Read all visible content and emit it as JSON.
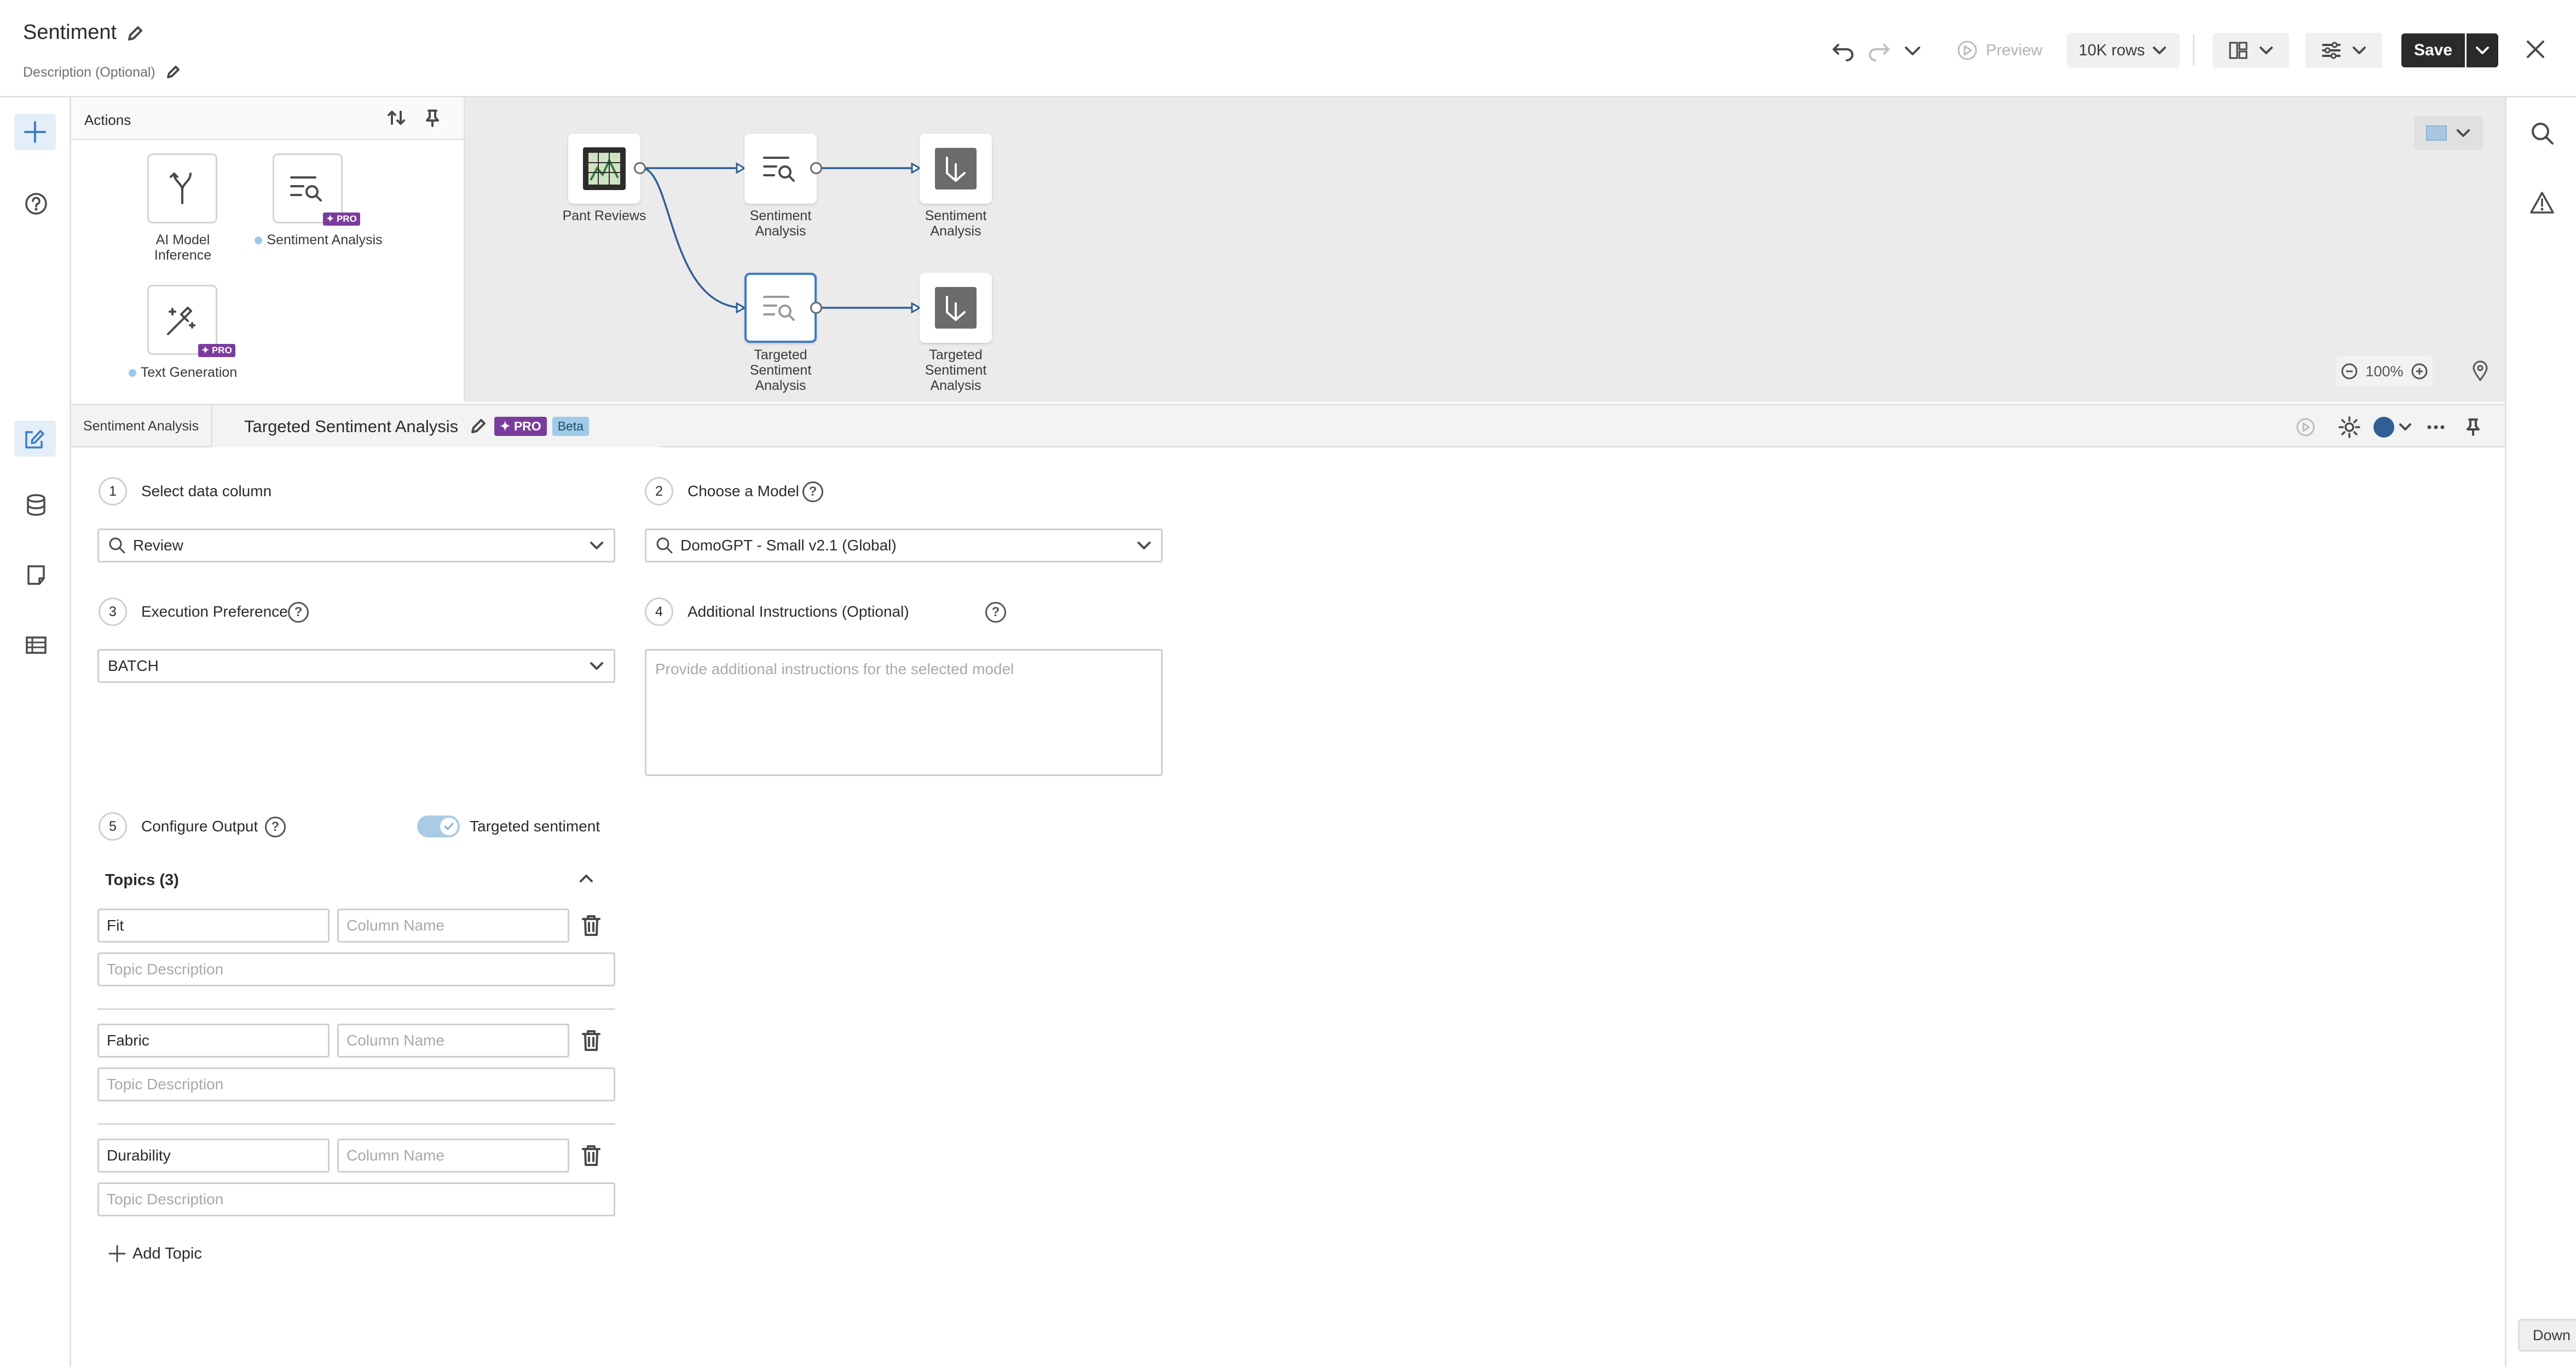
{
  "header": {
    "title": "Sentiment",
    "description": "Description (Optional)",
    "preview_label": "Preview",
    "rows_label": "10K rows",
    "save_label": "Save"
  },
  "actions": {
    "title": "Actions",
    "tiles": [
      {
        "label": "AI Model Inference",
        "pro": false,
        "icon": "fork-icon"
      },
      {
        "label": "Sentiment Analysis",
        "pro": true,
        "icon": "text-search-icon"
      },
      {
        "label": "Text Generation",
        "pro": true,
        "icon": "magic-wand-icon"
      }
    ],
    "pro_badge": "PRO"
  },
  "canvas": {
    "nodes": [
      {
        "label": "Pant Reviews"
      },
      {
        "label": "Sentiment Analysis"
      },
      {
        "label": "Sentiment Analysis"
      },
      {
        "label": "Targeted Sentiment Analysis"
      },
      {
        "label": "Targeted Sentiment Analysis"
      }
    ],
    "zoom": "100%"
  },
  "tabs": {
    "tab1": "Sentiment Analysis",
    "tab2": "Targeted Sentiment Analysis",
    "pro_badge": "PRO",
    "beta_badge": "Beta"
  },
  "form": {
    "step1": {
      "num": "1",
      "label": "Select data column",
      "value": "Review"
    },
    "step2": {
      "num": "2",
      "label": "Choose a Model",
      "value": "DomoGPT - Small v2.1 (Global)"
    },
    "step3": {
      "num": "3",
      "label": "Execution Preference",
      "value": "BATCH"
    },
    "step4": {
      "num": "4",
      "label": "Additional Instructions (Optional)",
      "placeholder": "Provide additional instructions for the selected model"
    },
    "step5": {
      "num": "5",
      "label": "Configure Output",
      "toggle_label": "Targeted sentiment",
      "toggle_on": true
    },
    "topics_title": "Topics (3)",
    "topics": [
      {
        "name": "Fit",
        "column_placeholder": "Column Name",
        "desc_placeholder": "Topic Description"
      },
      {
        "name": "Fabric",
        "column_placeholder": "Column Name",
        "desc_placeholder": "Topic Description"
      },
      {
        "name": "Durability",
        "column_placeholder": "Column Name",
        "desc_placeholder": "Topic Description"
      }
    ],
    "add_topic": "Add Topic"
  },
  "footer": {
    "corner_label": "Down"
  },
  "colors": {
    "accent": "#3d7cc9",
    "pro": "#7a3c9c",
    "beta": "#9fcbe9",
    "canvas": "#ebebeb"
  }
}
